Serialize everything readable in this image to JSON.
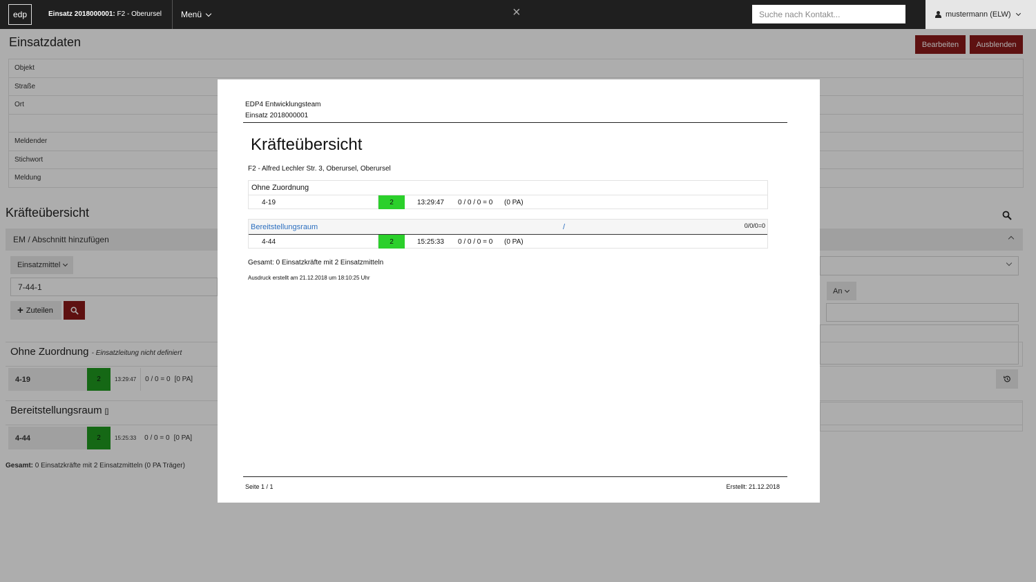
{
  "header": {
    "logo": "edp",
    "einsatz_bold": "Einsatz 2018000001:",
    "einsatz_rest": "F2 - Oberursel",
    "menu_label": "Menü",
    "close_label": "×",
    "search_placeholder": "Suche nach Kontakt...",
    "user_label": "mustermann (ELW)"
  },
  "einsatzdaten": {
    "title": "Einsatzdaten",
    "edit_label": "Bearbeiten",
    "hide_label": "Ausblenden",
    "fields": [
      "Objekt",
      "Straße",
      "Ort",
      "",
      "Meldender",
      "Stichwort",
      "Meldung"
    ]
  },
  "kraefte_bg": {
    "title": "Kräfteübersicht",
    "em_bar_label": "EM / Abschnitt hinzufügen",
    "einsatzmittel_label": "Einsatzmittel",
    "input_value": "7-44-1",
    "zuteilen_label": "Zuteilen",
    "an_label": "An",
    "group1_title": "Ohne Zuordnung",
    "group1_sub": "- Einsatzleitung nicht definiert",
    "group1_row": {
      "callsign": "4-19",
      "status": "2",
      "time": "13:29:47",
      "values": "0 / 0 = 0",
      "pa": "[0 PA]"
    },
    "group2_title": "Bereitstellungsraum",
    "group2_sub": "[]",
    "group2_row": {
      "callsign": "4-44",
      "status": "2",
      "time": "15:25:33",
      "values": "0 / 0 = 0",
      "pa": "[0 PA]"
    },
    "gesamt_label": "Gesamt:",
    "gesamt_text": "0 Einsatzkräfte mit 2 Einsatzmitteln (0 PA Träger)"
  },
  "modal": {
    "org": "EDP4 Entwicklungsteam",
    "einsatz": "Einsatz 2018000001",
    "title": "Kräfteübersicht",
    "address": "F2 - Alfred Lechler Str. 3, Oberursel, Oberursel",
    "section1": {
      "title": "Ohne Zuordnung",
      "row": {
        "callsign": "4-19",
        "status": "2",
        "time": "13:29:47",
        "values": "0 / 0 / 0 = 0",
        "pa": "(0 PA)"
      }
    },
    "section2": {
      "title": "Bereitstellungsraum",
      "slash": "/",
      "sum": "0/0/0=0",
      "row": {
        "callsign": "4-44",
        "status": "2",
        "time": "15:25:33",
        "values": "0 / 0 / 0 = 0",
        "pa": "(0 PA)"
      }
    },
    "gesamt": "Gesamt: 0 Einsatzkräfte mit 2 Einsatzmitteln",
    "ausdruck": "Ausdruck erstellt am 21.12.2018 um 18:10:25 Uhr",
    "page": "Seite 1 / 1",
    "created": "Erstellt: 21.12.2018"
  },
  "colors": {
    "topbar": "#1f1f1f",
    "accent_red": "#8b1a1a",
    "status_green": "#1f9a1f",
    "status_green_print": "#2bd02b",
    "link_blue": "#2c6fbf"
  }
}
